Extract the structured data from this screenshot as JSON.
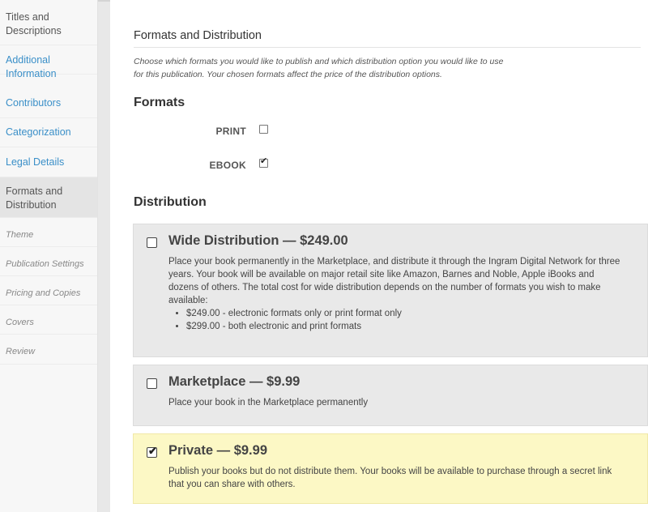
{
  "sidebar": {
    "items": [
      {
        "label": "Titles and Descriptions"
      },
      {
        "label": "Additional Information"
      },
      {
        "label": "Contributors"
      },
      {
        "label": "Categorization"
      },
      {
        "label": "Legal Details"
      },
      {
        "label": "Formats and Distribution"
      },
      {
        "label": "Theme"
      },
      {
        "label": "Publication Settings"
      },
      {
        "label": "Pricing and Copies"
      },
      {
        "label": "Covers"
      },
      {
        "label": "Review"
      }
    ]
  },
  "main": {
    "section_title": "Formats and Distribution",
    "intro": "Choose which formats you would like to publish and which distribution option you would like to use for this publication. Your chosen formats affect the price of the distribution options.",
    "formats_heading": "Formats",
    "formats": [
      {
        "label": "PRINT",
        "checked": false
      },
      {
        "label": "EBOOK",
        "checked": true
      }
    ],
    "distribution_heading": "Distribution",
    "options": [
      {
        "title": "Wide Distribution — $249.00",
        "description": "Place your book permanently in the Marketplace, and distribute it through the Ingram Digital Network for three years. Your book will be available on major retail site like Amazon, Barnes and Noble, Apple iBooks and dozens of others. The total cost for wide distribution depends on the number of formats you wish to make available:",
        "bullets": [
          "$249.00 - electronic formats only or print format only",
          "$299.00 - both electronic and print formats"
        ],
        "checked": false
      },
      {
        "title": "Marketplace — $9.99",
        "description": "Place your book in the Marketplace permanently",
        "checked": false
      },
      {
        "title": "Private — $9.99",
        "description": "Publish your books but do not distribute them. Your books will be available to purchase through a secret link that you can share with others.",
        "checked": true
      }
    ]
  },
  "colors": {
    "link": "#3a8fc8",
    "card_bg": "#e9e9e9",
    "selected_card_bg": "#fcf8c5",
    "sidebar_bg": "#f7f7f7",
    "page_bg": "#e8e8e8"
  },
  "icons": {
    "checked": "checkmark-icon"
  }
}
